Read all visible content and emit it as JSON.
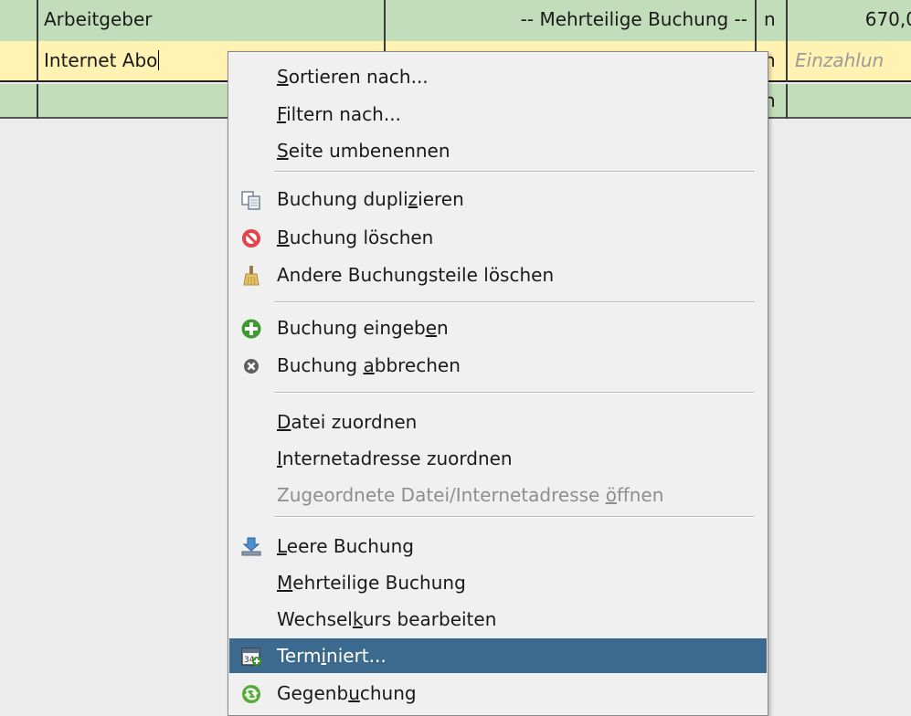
{
  "register": {
    "rows": [
      {
        "description": "Arbeitgeber",
        "transfer": "-- Mehrteilige Buchung --",
        "flag": "n",
        "amount": "670,0"
      },
      {
        "description": "Internet Abo",
        "flag": "n",
        "amount_placeholder": "Einzahlun"
      },
      {
        "flag": "n"
      }
    ]
  },
  "menu": {
    "items": [
      {
        "pre": "",
        "key": "S",
        "post": "ortieren nach..."
      },
      {
        "pre": "",
        "key": "F",
        "post": "iltern nach..."
      },
      {
        "pre": "",
        "key": "S",
        "post": "eite umbenennen"
      },
      {
        "pre": "Buchung dupli",
        "key": "z",
        "post": "ieren",
        "icon": "duplicate-icon"
      },
      {
        "pre": "",
        "key": "B",
        "post": "uchung löschen",
        "icon": "delete-icon"
      },
      {
        "pre": "Andere Buchungsteile löschen",
        "key": "",
        "post": "",
        "icon": "broom-icon"
      },
      {
        "pre": "Buchung eingeb",
        "key": "e",
        "post": "n",
        "icon": "enter-icon"
      },
      {
        "pre": "Buchung ",
        "key": "a",
        "post": "bbrechen",
        "icon": "cancel-icon"
      },
      {
        "pre": "",
        "key": "D",
        "post": "atei zuordnen"
      },
      {
        "pre": "",
        "key": "I",
        "post": "nternetadresse zuordnen"
      },
      {
        "pre": "Zugeordnete Datei/Internetadresse ",
        "key": "ö",
        "post": "ffnen",
        "disabled": true
      },
      {
        "pre": "",
        "key": "L",
        "post": "eere Buchung",
        "icon": "blank-transaction-icon"
      },
      {
        "pre": "",
        "key": "M",
        "post": "ehrteilige Buchung"
      },
      {
        "pre": "Wechsel",
        "key": "k",
        "post": "urs bearbeiten"
      },
      {
        "pre": "Term",
        "key": "i",
        "post": "niert...",
        "icon": "schedule-icon",
        "highlighted": true
      },
      {
        "pre": "Gegenb",
        "key": "u",
        "post": "chung",
        "icon": "jump-icon"
      }
    ]
  },
  "colors": {
    "row_green": "#c2ddb9",
    "row_yellow": "#fff2b2",
    "menu_bg": "#f0f0f0",
    "highlight": "#3b6a8e"
  }
}
